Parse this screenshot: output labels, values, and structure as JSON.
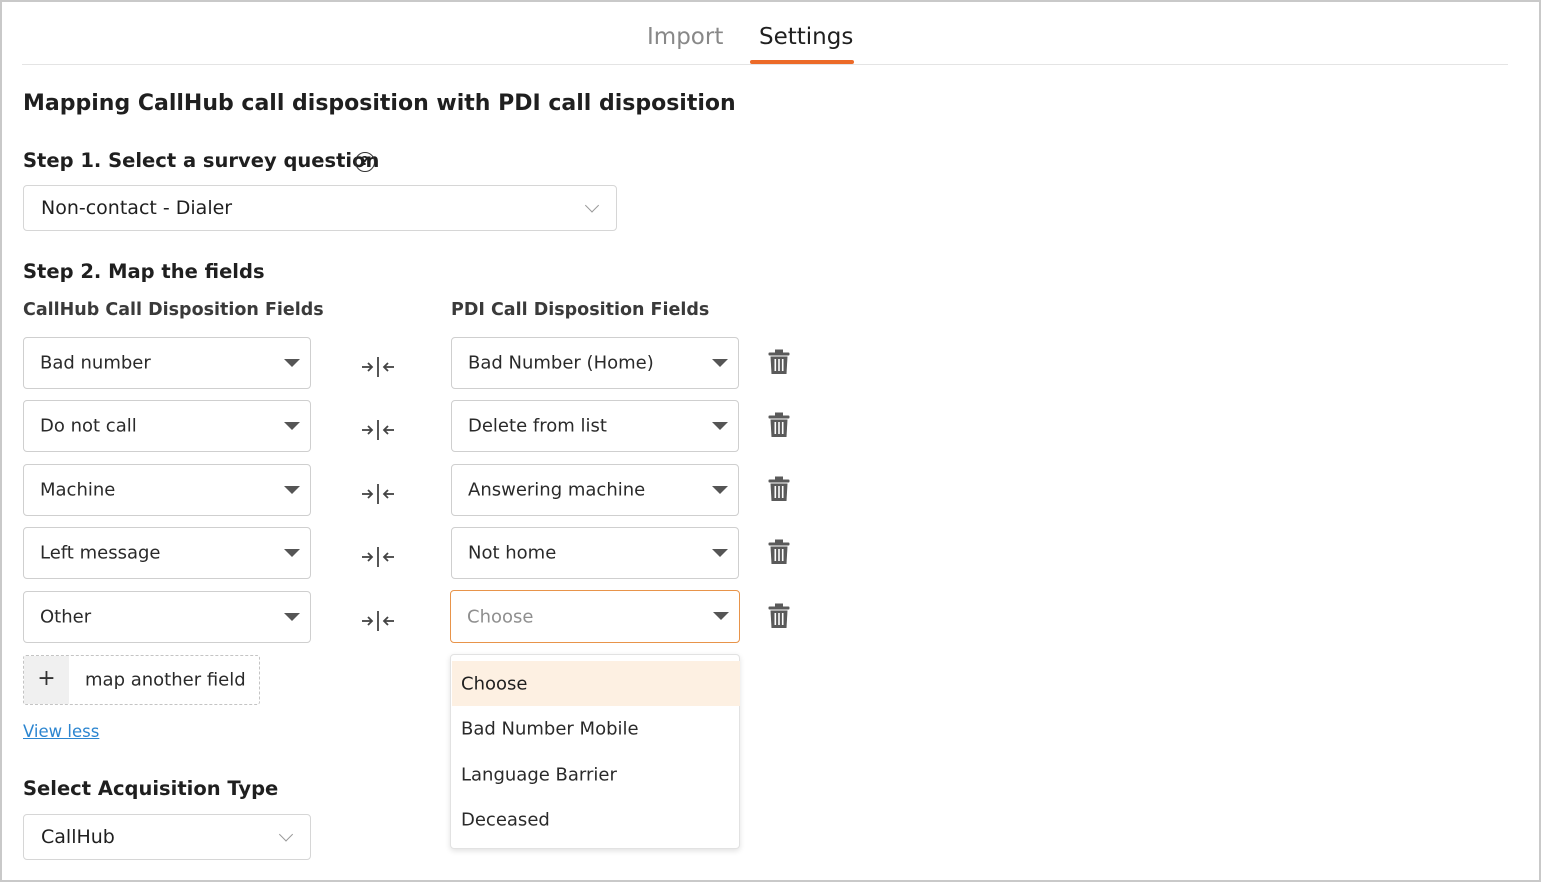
{
  "colors": {
    "accent": "#ec6a28",
    "link": "#2b85d0",
    "selected_bg": "#fdf0e2"
  },
  "tabs": [
    {
      "label": "Import",
      "active": false
    },
    {
      "label": "Settings",
      "active": true
    }
  ],
  "main": {
    "title": "Mapping CallHub call disposition with PDI call disposition",
    "step1": {
      "heading": "Step 1. Select a survey question",
      "help_icon": "question-circle-icon",
      "help_glyph": "?",
      "selected": "Non-contact - Dialer"
    },
    "step2": {
      "heading": "Step 2. Map the fields",
      "left_header": "CallHub Call Disposition Fields",
      "right_header": "PDI Call Disposition Fields",
      "rows": [
        {
          "callhub": "Bad number",
          "pdi": "Bad Number (Home)"
        },
        {
          "callhub": "Do not call",
          "pdi": "Delete from list"
        },
        {
          "callhub": "Machine",
          "pdi": "Answering machine"
        },
        {
          "callhub": "Left message",
          "pdi": "Not home"
        },
        {
          "callhub": "Other",
          "pdi": "Choose"
        }
      ],
      "add_symbol": "+",
      "add_label": "map another field",
      "view_less": "View less"
    },
    "acquisition": {
      "heading": "Select Acquisition Type",
      "selected": "CallHub"
    }
  },
  "dropdown_menu": {
    "items": [
      "Choose",
      "Bad Number Mobile",
      "Language Barrier",
      "Deceased"
    ],
    "selected_index": 0
  }
}
